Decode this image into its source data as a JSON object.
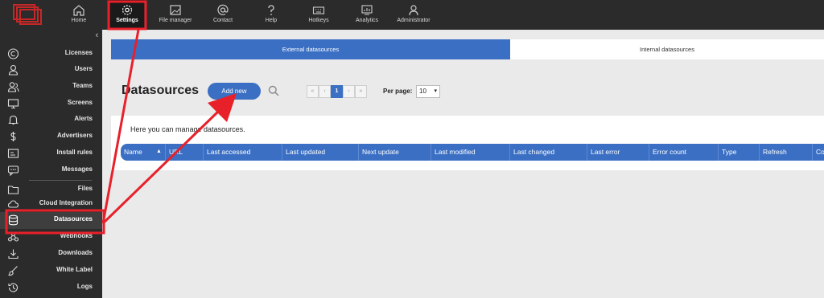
{
  "topnav": {
    "items": [
      {
        "label": "Home",
        "icon": "home-icon"
      },
      {
        "label": "Settings",
        "icon": "gear-icon"
      },
      {
        "label": "File manager",
        "icon": "image-icon"
      },
      {
        "label": "Contact",
        "icon": "at-icon"
      },
      {
        "label": "Help",
        "icon": "question-icon"
      },
      {
        "label": "Hotkeys",
        "icon": "keyboard-icon"
      },
      {
        "label": "Analytics",
        "icon": "monitor-chart-icon"
      },
      {
        "label": "Administrator",
        "icon": "user-icon"
      }
    ],
    "active": "Settings"
  },
  "sidebar": {
    "collapse_glyph": "‹",
    "items": [
      {
        "label": "Licenses",
        "icon": "copyright-icon"
      },
      {
        "label": "Users",
        "icon": "user-icon"
      },
      {
        "label": "Teams",
        "icon": "users-icon"
      },
      {
        "label": "Screens",
        "icon": "monitor-icon"
      },
      {
        "label": "Alerts",
        "icon": "bell-icon"
      },
      {
        "label": "Advertisers",
        "icon": "dollar-icon"
      },
      {
        "label": "Install rules",
        "icon": "install-icon"
      },
      {
        "label": "Messages",
        "icon": "message-icon"
      },
      {
        "label": "Files",
        "icon": "folder-icon"
      },
      {
        "label": "Cloud Integration",
        "icon": "cloud-icon"
      },
      {
        "label": "Datasources",
        "icon": "database-icon"
      },
      {
        "label": "Webhooks",
        "icon": "webhook-icon"
      },
      {
        "label": "Downloads",
        "icon": "download-icon"
      },
      {
        "label": "White Label",
        "icon": "brush-icon"
      },
      {
        "label": "Logs",
        "icon": "history-icon"
      }
    ],
    "active": "Datasources"
  },
  "tabs": {
    "external": "External datasources",
    "internal": "Internal datasources"
  },
  "page": {
    "title": "Datasources",
    "add_new": "Add new",
    "description": "Here you can manage datasources."
  },
  "pager": {
    "first": "«",
    "prev": "‹",
    "current": "1",
    "next": "›",
    "last": "»",
    "per_page_label": "Per page:",
    "per_page_value": "10",
    "caret": "▾"
  },
  "table": {
    "columns": [
      "Name",
      "URL",
      "Last accessed",
      "Last updated",
      "Next update",
      "Last modified",
      "Last changed",
      "Last error",
      "Error count",
      "Type",
      "Refresh",
      "Co"
    ],
    "sort_glyph": "▲"
  },
  "colors": {
    "accent": "#3a6fc4",
    "topbar": "#2b2b2b",
    "annotation": "#e8202a"
  }
}
